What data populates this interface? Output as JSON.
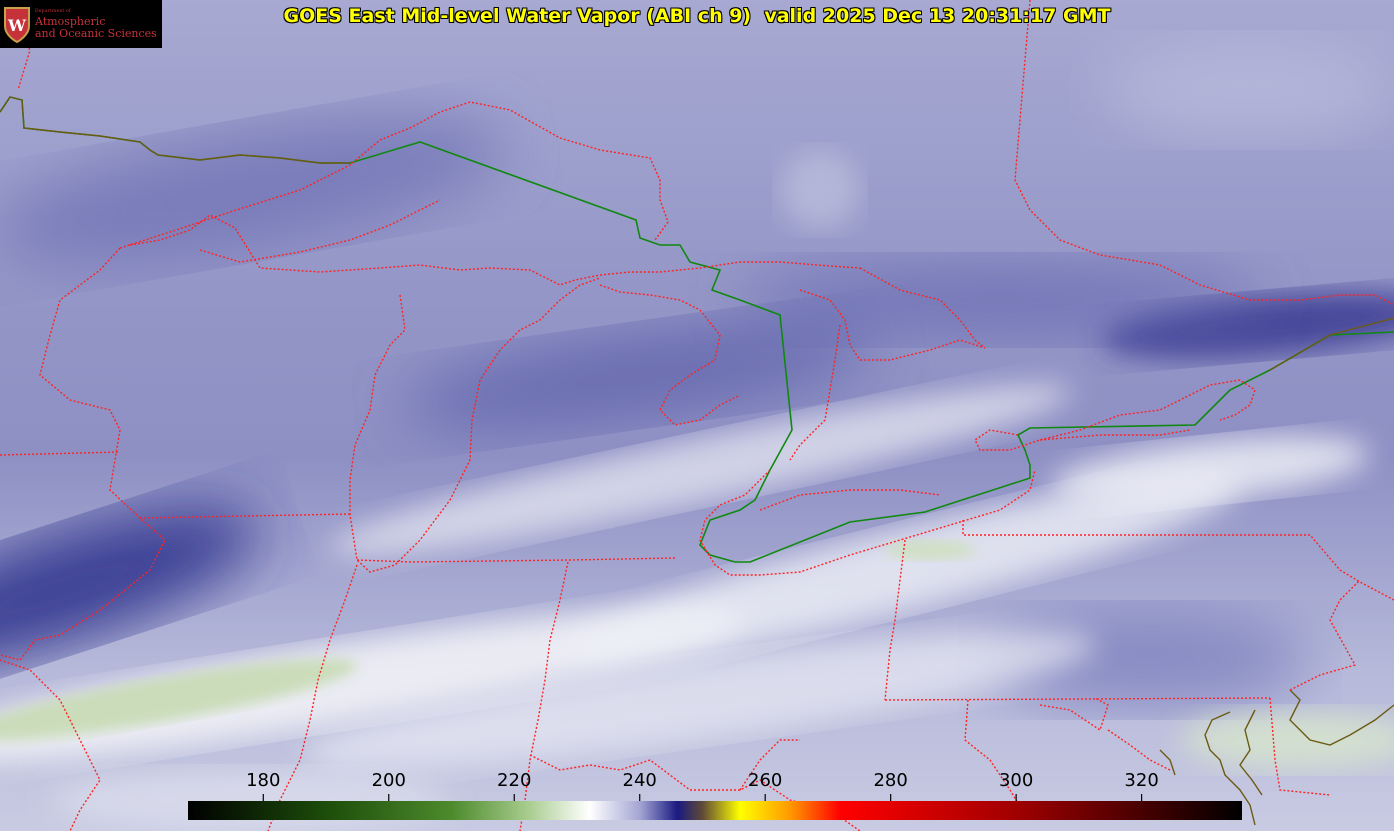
{
  "title": "GOES East Mid-level Water Vapor (ABI ch 9)  valid 2025 Dec 13 20:31:17 GMT",
  "logo": {
    "dept": "Department of",
    "line1": "Atmospheric",
    "line2": "and Oceanic Sciences",
    "crest_letter": "W",
    "crest_color": "#c5323a"
  },
  "colorbar": {
    "ticks": [
      "180",
      "200",
      "220",
      "240",
      "260",
      "280",
      "300",
      "320"
    ],
    "range": [
      168,
      336
    ],
    "stops": [
      {
        "v": 168,
        "c": "#000000"
      },
      {
        "v": 190,
        "c": "#1c4d0a"
      },
      {
        "v": 210,
        "c": "#4d8a2c"
      },
      {
        "v": 222,
        "c": "#a6cb8c"
      },
      {
        "v": 232,
        "c": "#ffffff"
      },
      {
        "v": 240,
        "c": "#a4a6d4"
      },
      {
        "v": 246,
        "c": "#1a1a82"
      },
      {
        "v": 250,
        "c": "#5f4a36"
      },
      {
        "v": 256,
        "c": "#ffff00"
      },
      {
        "v": 264,
        "c": "#ff9900"
      },
      {
        "v": 272,
        "c": "#ff0000"
      },
      {
        "v": 300,
        "c": "#a00000"
      },
      {
        "v": 336,
        "c": "#000000"
      }
    ]
  },
  "colors": {
    "state_borders": "#ff2222",
    "international_border": "#118811",
    "coastline": "#665511",
    "background_vapor": "#8e91c4"
  }
}
